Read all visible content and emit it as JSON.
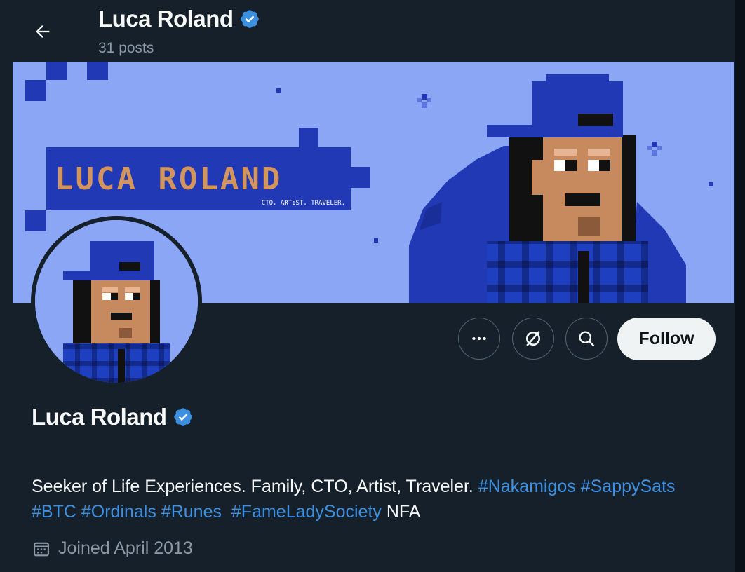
{
  "header": {
    "title": "Luca Roland",
    "posts": "31 posts"
  },
  "banner": {
    "title": "LUCA ROLAND",
    "subtitle": "CTO, ARTiST, TRAVELER."
  },
  "actions": {
    "follow_label": "Follow"
  },
  "profile": {
    "name": "Luca Roland",
    "bio": {
      "text1": "Seeker of Life Experiences. Family, CTO, Artist, Traveler.",
      "tag1": "#Nakamigos",
      "tag2": "#SappySats",
      "tag3": "#BTC",
      "tag4": "#Ordinals",
      "tag5": "#Runes",
      "tag6": "#FameLadySociety",
      "text2": "NFA"
    },
    "joined": "Joined April 2013"
  },
  "icons": [
    "back-arrow-icon",
    "verified-badge-icon",
    "more-icon",
    "subscribe-icon",
    "search-icon",
    "calendar-icon"
  ],
  "colors": {
    "background": "#15202b",
    "accent": "#1d9bf0",
    "hashtag": "#3d8fe0",
    "muted": "#8b98a5",
    "banner_bg": "#8aa6f5",
    "banner_blue": "#2139b5"
  }
}
